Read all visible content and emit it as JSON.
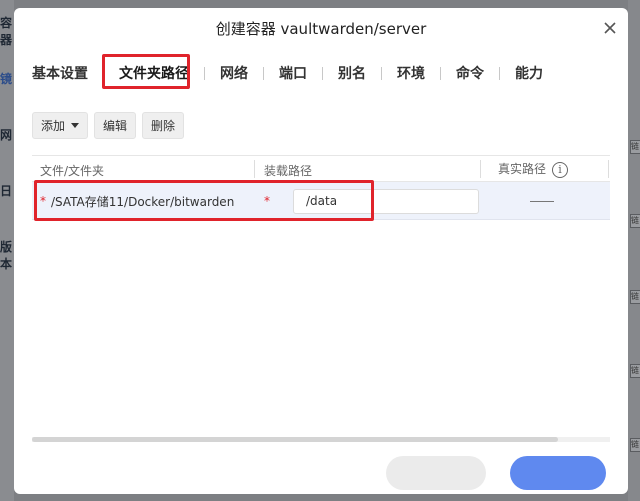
{
  "background": {
    "left_labels": [
      "容器",
      "镜",
      "网",
      "日",
      "版本"
    ],
    "right_tag": "链"
  },
  "dialog": {
    "title": "创建容器 vaultwarden/server",
    "tabs": [
      {
        "label": "基本设置",
        "active": false
      },
      {
        "label": "文件夹路径",
        "active": true
      },
      {
        "label": "网络",
        "active": false
      },
      {
        "label": "端口",
        "active": false
      },
      {
        "label": "别名",
        "active": false
      },
      {
        "label": "环境",
        "active": false
      },
      {
        "label": "命令",
        "active": false
      },
      {
        "label": "能力",
        "active": false
      }
    ],
    "toolbar": {
      "add_label": "添加",
      "edit_label": "编辑",
      "delete_label": "删除"
    },
    "table": {
      "columns": [
        "文件/文件夹",
        "装载路径",
        "真实路径"
      ],
      "info_icon_glyph": "i",
      "rows": [
        {
          "required_mark_1": "*",
          "host_path": "/SATA存储11/Docker/bitwarden",
          "required_mark_2": "*",
          "mount_path": "/data"
        }
      ]
    },
    "footer": {
      "cancel_label": "",
      "ok_label": ""
    }
  },
  "colors": {
    "accent": "#3d6fd9",
    "primary_button": "#5f89ef",
    "highlight_box": "#e0232b",
    "row_bg": "#eef2fb"
  }
}
